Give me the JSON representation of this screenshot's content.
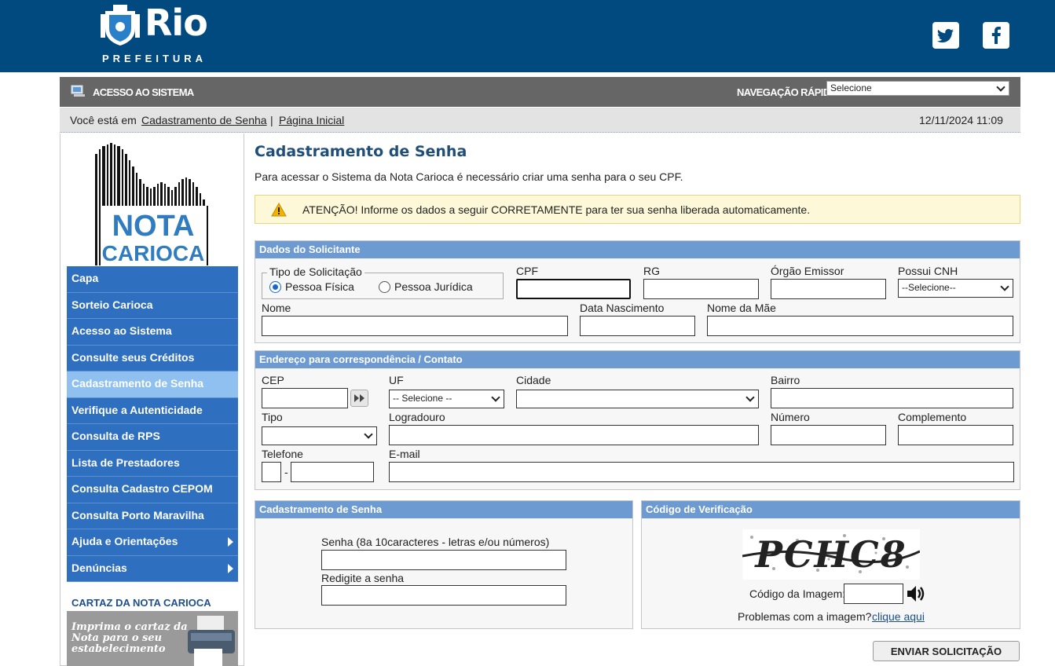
{
  "header": {
    "brand": "Rio",
    "brand_sub": "PREFEITURA",
    "twitter_icon": "twitter-icon",
    "facebook_icon": "facebook-icon",
    "bg_color": "#004a80"
  },
  "system_bar": {
    "access_label": "ACESSO AO SISTEMA",
    "quick_nav_label": "NAVEGAÇÃO RÁPIDA",
    "quick_nav_selected": "Selecione"
  },
  "breadcrumb": {
    "prefix": "Você está em",
    "item1": "Cadastramento de Senha",
    "separator": "|",
    "item2": "Página Inicial",
    "datetime": "12/11/2024 11:09"
  },
  "sidebar": {
    "logo_text_1": "NOTA",
    "logo_text_2": "CARIOCA",
    "items": [
      {
        "label": "Capa"
      },
      {
        "label": "Sorteio Carioca"
      },
      {
        "label": "Acesso ao Sistema"
      },
      {
        "label": "Consulte seus Créditos"
      },
      {
        "label": "Cadastramento de Senha"
      },
      {
        "label": "Verifique a Autenticidade"
      },
      {
        "label": "Consulta de RPS"
      },
      {
        "label": "Lista de Prestadores"
      },
      {
        "label": "Consulta Cadastro CEPOM"
      },
      {
        "label": "Consulta Porto Maravilha"
      },
      {
        "label": "Ajuda e Orientações"
      },
      {
        "label": "Denúncias"
      }
    ],
    "cartaz_title": "CARTAZ DA NOTA CARIOCA",
    "cartaz_text": "Imprima o cartaz da Nota para o seu estabelecimento"
  },
  "main": {
    "title": "Cadastramento de Senha",
    "intro": "Para acessar o Sistema da Nota Carioca é necessário criar uma senha para o seu CPF.",
    "warning": "ATENÇÃO! Informe os dados a seguir CORRETAMENTE para ter sua senha liberada automaticamente."
  },
  "solicitante": {
    "title": "Dados do Solicitante",
    "tipo_legend": "Tipo de Solicitação",
    "pf_label": "Pessoa Física",
    "pj_label": "Pessoa Jurídica",
    "cpf_label": "CPF",
    "rg_label": "RG",
    "orgao_label": "Órgão Emissor",
    "cnh_label": "Possui CNH",
    "cnh_selected": "--Selecione--",
    "nome_label": "Nome",
    "nasc_label": "Data Nascimento",
    "mae_label": "Nome da Mãe"
  },
  "endereco": {
    "title": "Endereço para correspondência / Contato",
    "cep_label": "CEP",
    "uf_label": "UF",
    "uf_selected": "-- Selecione --",
    "cidade_label": "Cidade",
    "bairro_label": "Bairro",
    "tipo_label": "Tipo",
    "logradouro_label": "Logradouro",
    "numero_label": "Número",
    "complemento_label": "Complemento",
    "telefone_label": "Telefone",
    "tel_sep": "-",
    "email_label": "E-mail"
  },
  "senha": {
    "title": "Cadastramento de Senha",
    "senha_label": "Senha (8a 10caracteres - letras e/ou números)",
    "redigite_label": "Redigite a senha"
  },
  "verificacao": {
    "title": "Código de Verificação",
    "captcha_text": "PCHC8",
    "codigo_label": "Código da Imagem:",
    "problema_text": "Problemas com a imagem?",
    "problema_link": "clique aqui"
  },
  "submit_label": "ENVIAR SOLICITAÇÃO"
}
